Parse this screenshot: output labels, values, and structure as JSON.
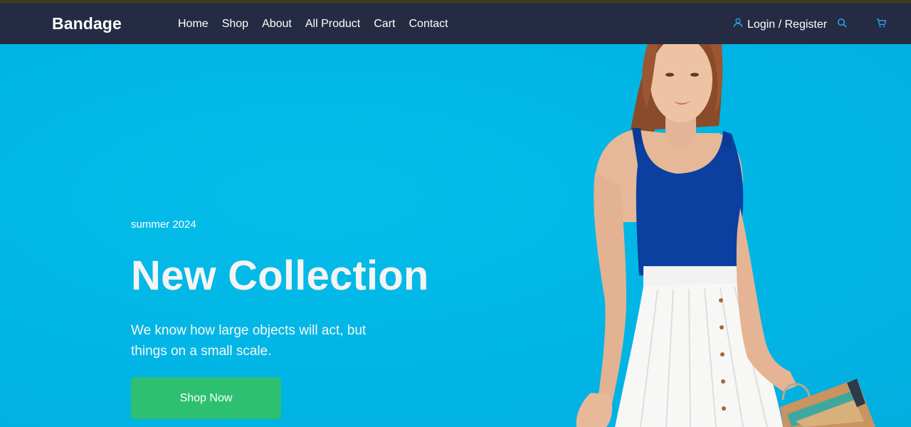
{
  "header": {
    "brand": "Bandage",
    "nav": [
      {
        "label": "Home"
      },
      {
        "label": "Shop"
      },
      {
        "label": "About"
      },
      {
        "label": "All Product"
      },
      {
        "label": "Cart"
      },
      {
        "label": "Contact"
      }
    ],
    "login_label": "Login / Register",
    "icons": {
      "user": "user-icon",
      "search": "search-icon",
      "cart": "cart-icon"
    }
  },
  "hero": {
    "season": "summer 2024",
    "title": "New Collection",
    "description": "We know how large objects will act, but things on a small scale.",
    "cta_label": "Shop Now"
  },
  "colors": {
    "navbar": "#252b42",
    "hero_background": "#00b7e6",
    "cta": "#2dc071",
    "icon_accent": "#23a6f0"
  }
}
